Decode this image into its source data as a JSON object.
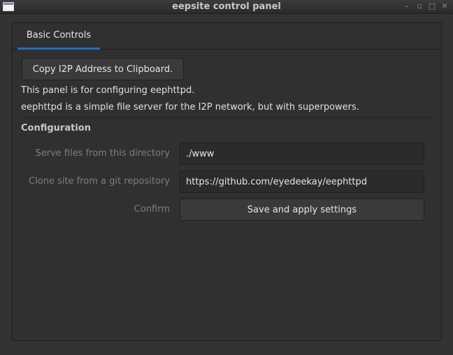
{
  "window": {
    "title": "eepsite control panel",
    "controls": {
      "minimize": "–",
      "restore": "▫",
      "maximize": "□",
      "close": "✕"
    }
  },
  "tabs": [
    {
      "label": "Basic Controls",
      "active": true
    }
  ],
  "basic": {
    "copy_button_label": "Copy I2P Address to Clipboard.",
    "info_line_1": "This panel is for configuring eephttpd.",
    "info_line_2": "eephttpd is a simple file server for the I2P network, but with superpowers.",
    "section_title": "Configuration",
    "fields": {
      "serve_dir_label": "Serve files from this directory",
      "serve_dir_value": "./www",
      "git_label": "Clone site from a git repository",
      "git_value": "https://github.com/eyedeekay/eephttpd",
      "confirm_label": "Confirm",
      "save_button_label": "Save and apply settings"
    }
  },
  "colors": {
    "background": "#333333",
    "accent": "#2a6bbd",
    "text": "#e0e0e0",
    "muted_text": "#7e7e7e"
  }
}
